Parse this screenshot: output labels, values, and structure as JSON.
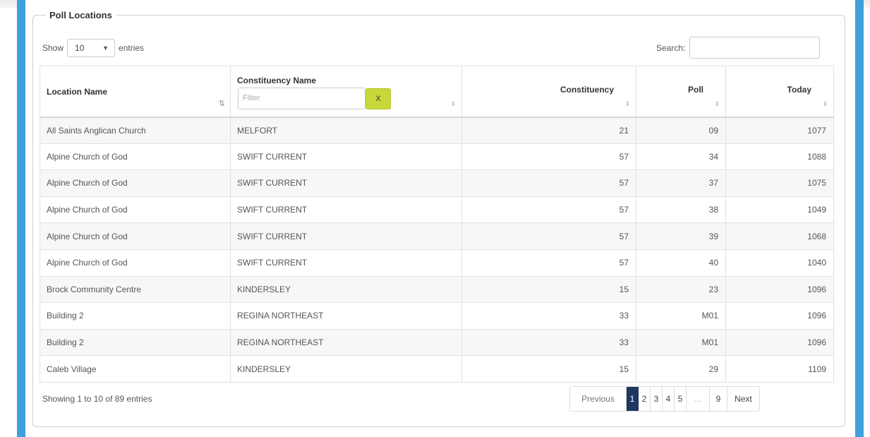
{
  "panel": {
    "legend": "Poll Locations"
  },
  "length_menu": {
    "prefix": "Show",
    "selected": "10",
    "suffix": "entries"
  },
  "search": {
    "label": "Search:",
    "value": ""
  },
  "table": {
    "headers": {
      "location": "Location Name",
      "constituency_name": "Constituency Name",
      "constituency": "Constituency",
      "poll": "Poll",
      "today": "Today"
    },
    "filter": {
      "placeholder": "Filter",
      "clear_label": "X"
    },
    "rows": [
      [
        "All Saints Anglican Church",
        "MELFORT",
        "21",
        "09",
        "1077"
      ],
      [
        "Alpine Church of God",
        "SWIFT CURRENT",
        "57",
        "34",
        "1088"
      ],
      [
        "Alpine Church of God",
        "SWIFT CURRENT",
        "57",
        "37",
        "1075"
      ],
      [
        "Alpine Church of God",
        "SWIFT CURRENT",
        "57",
        "38",
        "1049"
      ],
      [
        "Alpine Church of God",
        "SWIFT CURRENT",
        "57",
        "39",
        "1068"
      ],
      [
        "Alpine Church of God",
        "SWIFT CURRENT",
        "57",
        "40",
        "1040"
      ],
      [
        "Brock Community Centre",
        "KINDERSLEY",
        "15",
        "23",
        "1096"
      ],
      [
        "Building 2",
        "REGINA NORTHEAST",
        "33",
        "M01",
        "1096"
      ],
      [
        "Building 2",
        "REGINA NORTHEAST",
        "33",
        "M01",
        "1096"
      ],
      [
        "Caleb Village",
        "KINDERSLEY",
        "15",
        "29",
        "1109"
      ]
    ]
  },
  "info": "Showing 1 to 10 of 89 entries",
  "pagination": {
    "previous": "Previous",
    "pages": [
      "1",
      "2",
      "3",
      "4",
      "5"
    ],
    "active_page": "1",
    "ellipsis": "…",
    "last": "9",
    "next": "Next"
  },
  "colors": {
    "frame": "#3fa1dc",
    "active_page": "#1e3860",
    "clear_button": "#c7d93a"
  }
}
